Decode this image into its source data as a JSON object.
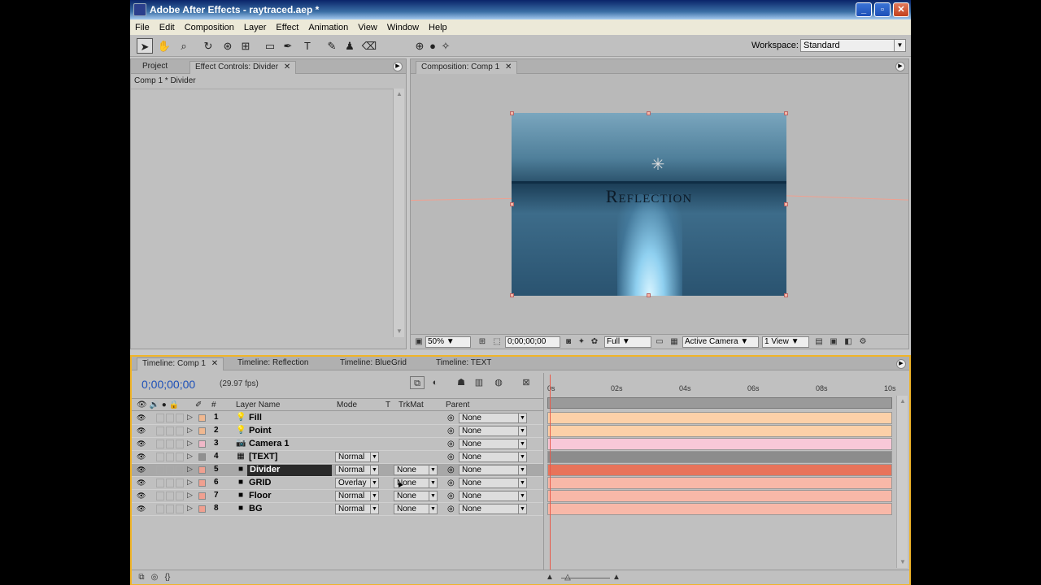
{
  "window": {
    "title": "Adobe After Effects - raytraced.aep *",
    "min": "_",
    "max": "▫",
    "close": "✕"
  },
  "menu": [
    "File",
    "Edit",
    "Composition",
    "Layer",
    "Effect",
    "Animation",
    "View",
    "Window",
    "Help"
  ],
  "toolbar": {
    "workspace_label": "Workspace:",
    "workspace_value": "Standard"
  },
  "left_panel": {
    "tab_project": "Project",
    "tab_effect_controls": "Effect Controls: Divider",
    "breadcrumb": "Comp 1 * Divider"
  },
  "comp_panel": {
    "tab": "Composition: Comp 1",
    "title_text": "Reflection",
    "zoom": "50%",
    "timecode": "0;00;00;00",
    "resolution": "Full",
    "camera": "Active Camera",
    "views": "1 View"
  },
  "timeline": {
    "tabs": [
      "Timeline: Comp 1",
      "Timeline: Reflection",
      "Timeline: BlueGrid",
      "Timeline: TEXT"
    ],
    "timecode": "0;00;00;00",
    "fps": "(29.97 fps)",
    "headers": {
      "hash": "#",
      "layer_name": "Layer Name",
      "mode": "Mode",
      "t": "T",
      "trkmat": "TrkMat",
      "parent": "Parent"
    },
    "ticks": [
      "0s",
      "02s",
      "04s",
      "06s",
      "08s",
      "10s"
    ],
    "layers": [
      {
        "num": "1",
        "name": "Fill",
        "icon": "light-icon",
        "color": "#f0b890",
        "mode": "",
        "trkmat": "",
        "parent": "None",
        "bar": "#fcd0a8"
      },
      {
        "num": "2",
        "name": "Point",
        "icon": "light-icon",
        "color": "#f0b890",
        "mode": "",
        "trkmat": "",
        "parent": "None",
        "bar": "#fcd0a8"
      },
      {
        "num": "3",
        "name": "Camera 1",
        "icon": "camera-icon",
        "color": "#f0b8c8",
        "mode": "",
        "trkmat": "",
        "parent": "None",
        "bar": "#f8c8d8"
      },
      {
        "num": "4",
        "name": "[TEXT]",
        "icon": "precomp-icon",
        "color": "#909090",
        "mode": "Normal",
        "trkmat": "",
        "parent": "None",
        "bar": "#8c8c8c"
      },
      {
        "num": "5",
        "name": "Divider",
        "icon": "solid-icon",
        "color": "#f0a090",
        "mode": "Normal",
        "trkmat": "None",
        "parent": "None",
        "bar": "#e8735a"
      },
      {
        "num": "6",
        "name": "GRID",
        "icon": "solid-icon",
        "color": "#f0a090",
        "mode": "Overlay",
        "trkmat": "None",
        "parent": "None",
        "bar": "#f8b8a8"
      },
      {
        "num": "7",
        "name": "Floor",
        "icon": "solid-icon",
        "color": "#f0a090",
        "mode": "Normal",
        "trkmat": "None",
        "parent": "None",
        "bar": "#f8b8a8"
      },
      {
        "num": "8",
        "name": "BG",
        "icon": "solid-icon",
        "color": "#f0a090",
        "mode": "Normal",
        "trkmat": "None",
        "parent": "None",
        "bar": "#f8b8a8"
      }
    ]
  }
}
